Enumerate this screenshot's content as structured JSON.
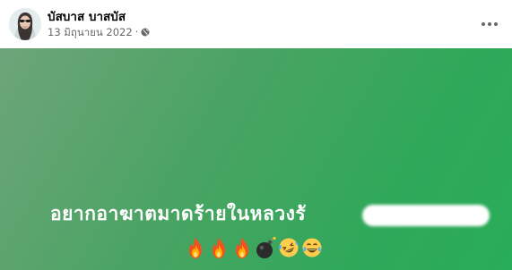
{
  "post": {
    "author": "บัสบาส บาสบัส",
    "date": "13 มิถุนายน 2022",
    "separator": "·",
    "text": "อยากอาฆาตมาดร้ายในหลวงรั",
    "emojis": [
      "fire-icon",
      "fire-icon",
      "fire-icon",
      "bomb-icon",
      "rofl-face-icon",
      "laughing-tears-face-icon"
    ],
    "background_color": "#2fa85a",
    "text_color": "#ffffff"
  },
  "header": {
    "privacy_icon": "globe-icon",
    "menu_icon": "more-options-icon"
  }
}
